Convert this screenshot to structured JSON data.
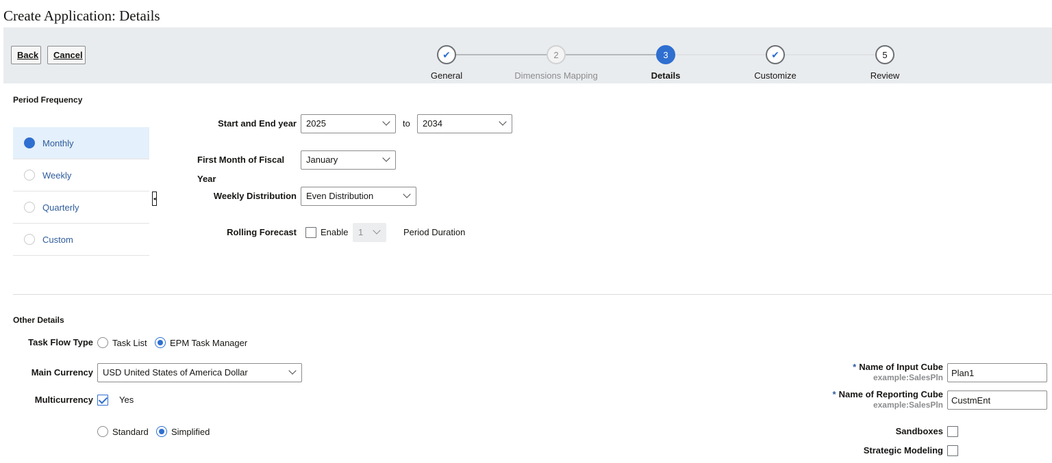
{
  "page": {
    "title": "Create Application: Details"
  },
  "toolbar": {
    "back_label": "Back",
    "cancel_label": "Cancel"
  },
  "train": {
    "steps": [
      {
        "number": "1",
        "label": "General",
        "state": "visited"
      },
      {
        "number": "2",
        "label": "Dimensions Mapping",
        "state": "disabled"
      },
      {
        "number": "3",
        "label": "Details",
        "state": "current"
      },
      {
        "number": "4",
        "label": "Customize",
        "state": "visited"
      },
      {
        "number": "5",
        "label": "Review",
        "state": "unvisited"
      }
    ]
  },
  "period_frequency": {
    "title": "Period Frequency",
    "items": [
      {
        "label": "Monthly",
        "selected": true
      },
      {
        "label": "Weekly",
        "selected": false
      },
      {
        "label": "Quarterly",
        "selected": false
      },
      {
        "label": "Custom",
        "selected": false
      }
    ],
    "start_end_label": "Start and End year",
    "start_year": "2025",
    "to_label": "to",
    "end_year": "2034",
    "first_month_label_line1": "First Month of Fiscal",
    "first_month_label_line2": "Year",
    "first_month_value": "January",
    "weekly_distribution_label": "Weekly Distribution",
    "weekly_distribution_value": "Even Distribution",
    "rolling_forecast_label": "Rolling Forecast",
    "enable_label": "Enable",
    "enable_checked": false,
    "duration_value": "1",
    "period_duration_label": "Period Duration"
  },
  "other_details": {
    "title": "Other Details",
    "task_flow_label": "Task Flow Type",
    "task_flow_options": [
      {
        "label": "Task List",
        "selected": false
      },
      {
        "label": "EPM Task Manager",
        "selected": true
      }
    ],
    "main_currency_label": "Main Currency",
    "main_currency_value": "USD United States of America Dollar",
    "multicurrency_label": "Multicurrency",
    "multicurrency_checked": true,
    "multicurrency_yes": "Yes",
    "currency_mode_options": [
      {
        "label": "Standard",
        "selected": false
      },
      {
        "label": "Simplified",
        "selected": true
      }
    ],
    "required_mark": "*",
    "input_cube_label": "Name of Input Cube",
    "input_cube_hint": "example:SalesPln",
    "input_cube_value": "Plan1",
    "reporting_cube_label": "Name of Reporting Cube",
    "reporting_cube_hint": "example:SalesPln",
    "reporting_cube_value": "CustmEnt",
    "sandboxes_label": "Sandboxes",
    "strategic_modeling_label": "Strategic Modeling"
  },
  "colors": {
    "accent": "#2f6fd0",
    "train_bg": "#e9ecee",
    "selected_bg": "#e4f0fb",
    "link": "#2f5c9c"
  }
}
